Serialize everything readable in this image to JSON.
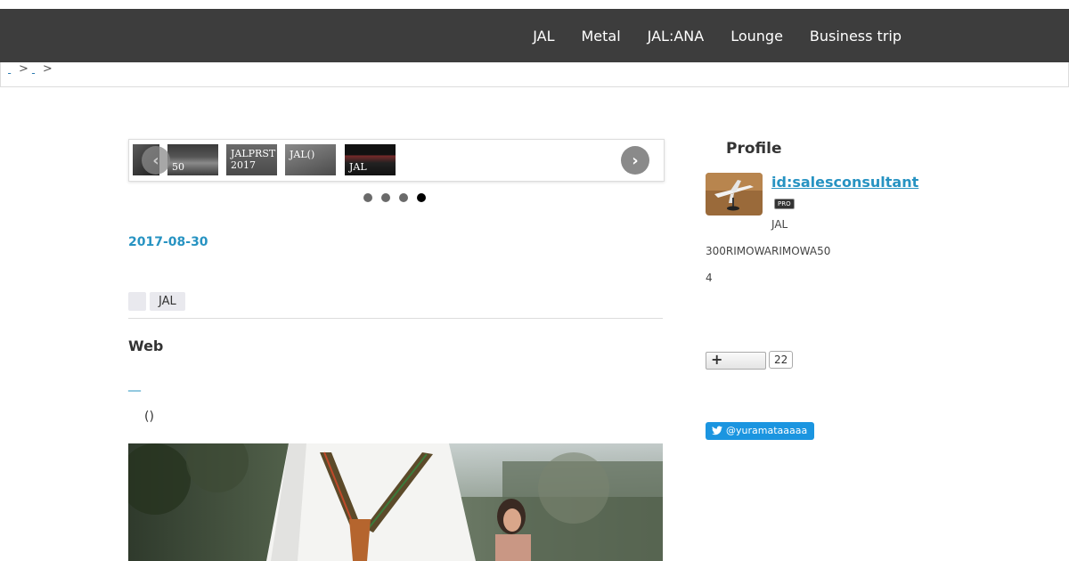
{
  "nav": {
    "items": [
      "JAL",
      "Metal",
      "JAL:ANA",
      "Lounge",
      "Business trip"
    ]
  },
  "breadcrumb": {
    "separator": ">"
  },
  "slider": {
    "thumbs": [
      {
        "caption": ""
      },
      {
        "caption": "50"
      },
      {
        "caption": "JALPRST 2017"
      },
      {
        "caption": "JAL()"
      },
      {
        "caption": "JAL"
      }
    ],
    "prev_icon": "‹",
    "next_icon": "›",
    "dot_count": 4,
    "active_dot": 4
  },
  "article": {
    "date": "2017-08-30",
    "categories": [
      "",
      "JAL"
    ],
    "title": "Web",
    "link_text": "__",
    "paren_text": "()"
  },
  "sidebar": {
    "heading": "Profile",
    "username": "id:salesconsultant",
    "badge": "PRO",
    "desc1": "JAL",
    "desc2": "300RIMOWARIMOWA50",
    "desc3": "4",
    "bookmark_count": "22",
    "twitter_handle": "@yuramataaaaa"
  },
  "colors": {
    "navbar": "#3d3d3d",
    "link": "#2793c2",
    "twitter": "#1b95e0"
  }
}
